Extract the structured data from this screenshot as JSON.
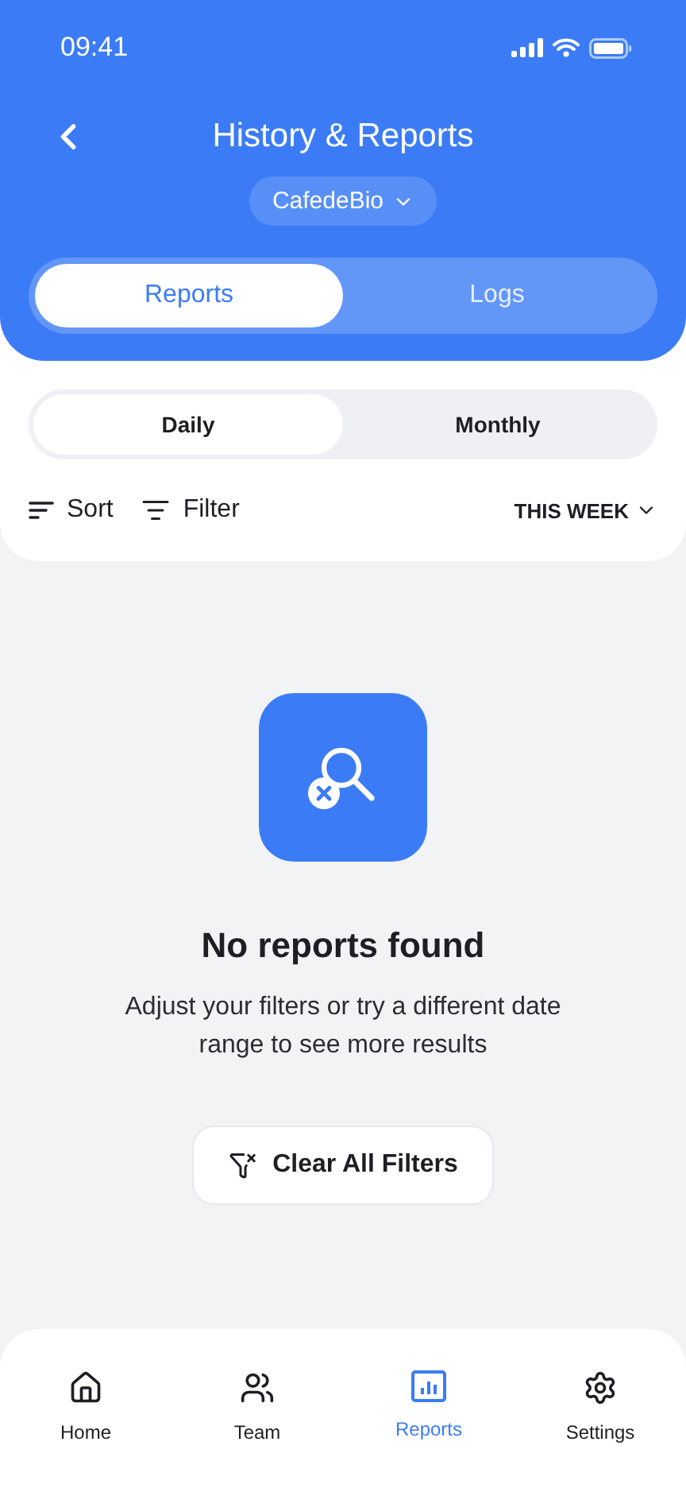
{
  "status_bar": {
    "time": "09:41"
  },
  "header": {
    "title": "History & Reports",
    "selector": "CafedeBio"
  },
  "tabs": [
    {
      "label": "Reports",
      "selected": true
    },
    {
      "label": "Logs",
      "selected": false
    }
  ],
  "periods": [
    {
      "label": "Daily",
      "selected": true
    },
    {
      "label": "Monthly",
      "selected": false
    }
  ],
  "toolbar": {
    "sort": "Sort",
    "filter": "Filter",
    "range": "THIS WEEK"
  },
  "empty_state": {
    "title": "No reports found",
    "message": "Adjust your filters or try a different date range to see more results",
    "button": "Clear All Filters"
  },
  "nav": [
    {
      "kind": "home",
      "label": "Home",
      "selected": false
    },
    {
      "kind": "team",
      "label": "Team",
      "selected": false
    },
    {
      "kind": "reports",
      "label": "Reports",
      "selected": true
    },
    {
      "kind": "settings",
      "label": "Settings",
      "selected": false
    }
  ]
}
